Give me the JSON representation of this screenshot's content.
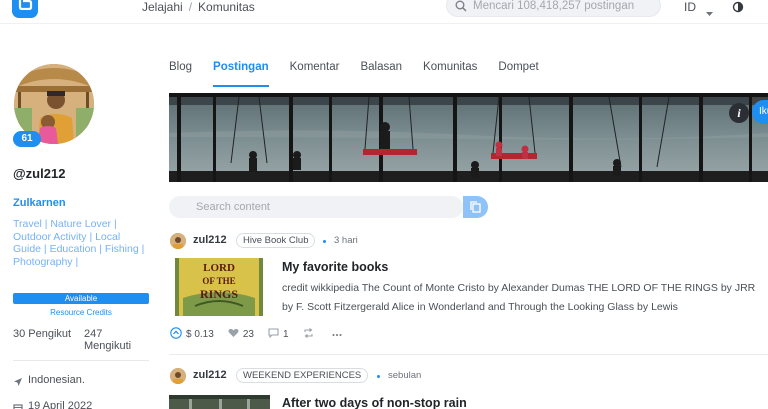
{
  "nav": {
    "breadcrumb_home": "Jelajahi",
    "breadcrumb_sep": "/",
    "breadcrumb_current": "Komunitas",
    "search_placeholder": "Mencari 108,418,257 postingan",
    "language": "ID"
  },
  "profile": {
    "reputation": "61",
    "username": "@zul212",
    "display_name": "Zulkarnen",
    "about": "Travel | Nature Lover | Outdoor Activity | Local Guide | Education | Fishing | Photography |",
    "availability": "Available",
    "resource_credits": "Resource Credits",
    "followers": "30 Pengikut",
    "following": "247 Mengikuti",
    "location": "Indonesian.",
    "joined": "19 April 2022"
  },
  "tabs": [
    {
      "label": "Blog"
    },
    {
      "label": "Postingan"
    },
    {
      "label": "Komentar"
    },
    {
      "label": "Balasan"
    },
    {
      "label": "Komunitas"
    },
    {
      "label": "Dompet"
    }
  ],
  "active_tab": "Postingan",
  "cover": {
    "info_label": "i",
    "follow_label": "Ikuti"
  },
  "content_search": {
    "placeholder": "Search content"
  },
  "posts": [
    {
      "author": "zul212",
      "community": "Hive Book Club",
      "time": "3 hari",
      "title": "My favorite books",
      "body": "credit wikkipedia The Count of Monte Cristo by Alexander Dumas THE LORD OF THE RINGS by JRR by F. Scott Fitzergerald Alice in Wonderland and Through the Looking Glass by Lewis",
      "thumb_text": "THE LORD OF THE RINGS",
      "payout": "$ 0.13",
      "votes": "23",
      "comments": "1"
    },
    {
      "author": "zul212",
      "community": "WEEKEND EXPERIENCES",
      "time": "sebulan",
      "title": "After two days of non-stop rain"
    }
  ],
  "colors": {
    "accent": "#1f8ef1",
    "accent_light": "#74b3f5",
    "text_main": "#212529",
    "text_muted": "#4a5058"
  },
  "icons": {
    "logo": "hive-logo-icon",
    "search": "search-icon",
    "caret": "chevron-down-icon",
    "theme": "half-moon-icon",
    "location": "location-arrow-icon",
    "calendar": "calendar-icon",
    "copy": "copy-icon",
    "upvote": "upvote-icon",
    "heart": "heart-icon",
    "comment": "comment-icon",
    "reblog": "reblog-icon",
    "more": "more-icon"
  }
}
